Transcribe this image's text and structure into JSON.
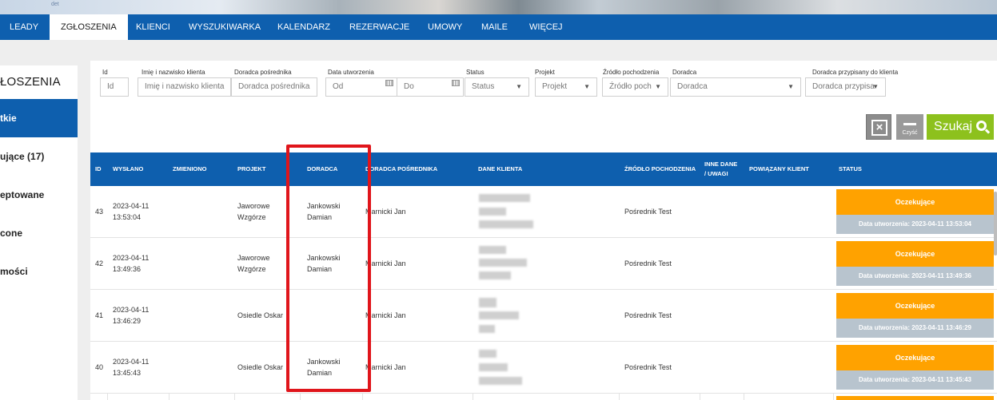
{
  "banner": {
    "logo_text": "det"
  },
  "nav": {
    "items": [
      {
        "label": "LEADY"
      },
      {
        "label": "ZGŁOSZENIA",
        "active": true
      },
      {
        "label": "KLIENCI"
      },
      {
        "label": "WYSZUKIWARKA"
      },
      {
        "label": "KALENDARZ"
      },
      {
        "label": "REZERWACJE"
      },
      {
        "label": "UMOWY"
      },
      {
        "label": "MAILE"
      },
      {
        "label": "WIĘCEJ"
      }
    ]
  },
  "sidebar": {
    "title": "ŁOSZENIA",
    "items": [
      {
        "label": "tkie",
        "active": true
      },
      {
        "label": "ujące (17)"
      },
      {
        "label": "eptowane"
      },
      {
        "label": "cone"
      },
      {
        "label": "mości"
      }
    ]
  },
  "filters": {
    "id": {
      "label": "Id",
      "placeholder": "Id"
    },
    "client_name": {
      "label": "Imię i nazwisko klienta",
      "placeholder": "Imię i nazwisko klienta"
    },
    "broker": {
      "label": "Doradca pośrednika",
      "placeholder": "Doradca pośrednika"
    },
    "created_date": {
      "label": "Data utworzenia",
      "from": "Od",
      "to": "Do"
    },
    "status": {
      "label": "Status",
      "value": "Status"
    },
    "project": {
      "label": "Projekt",
      "value": "Projekt"
    },
    "source": {
      "label": "Źródło pochodzenia",
      "value": "Źródło poch"
    },
    "advisor": {
      "label": "Doradca",
      "value": "Doradca"
    },
    "assigned_advisor": {
      "label": "Doradca przypisany do klienta",
      "value": "Doradca przypisa"
    }
  },
  "actions": {
    "clear_label": "Czyść",
    "search_label": "Szukaj"
  },
  "table": {
    "headers": {
      "id": "ID",
      "sent": "WYSŁANO",
      "changed": "ZMIENIONO",
      "project": "PROJEKT",
      "advisor": "DORADCA",
      "broker_advisor": "DORADCA POŚREDNIKA",
      "client_data": "DANE KLIENTA",
      "source": "ŹRÓDŁO POCHODZENIA",
      "other_1": "INNE DANE",
      "other_2": "/ UWAGI",
      "linked_client": "POWIĄZANY KLIENT",
      "status": "STATUS"
    },
    "rows": [
      {
        "id": "43",
        "sent_date": "2023-04-11",
        "sent_time": "13:53:04",
        "project_1": "Jaworowe",
        "project_2": "Wzgórze",
        "advisor_1": "Jankowski",
        "advisor_2": "Damian",
        "broker": "Marnicki Jan",
        "source": "Pośrednik Test",
        "status": "Oczekujące",
        "status_info": "Data utworzenia: 2023-04-11 13:53:04"
      },
      {
        "id": "42",
        "sent_date": "2023-04-11",
        "sent_time": "13:49:36",
        "project_1": "Jaworowe",
        "project_2": "Wzgórze",
        "advisor_1": "Jankowski",
        "advisor_2": "Damian",
        "broker": "Marnicki Jan",
        "source": "Pośrednik Test",
        "status": "Oczekujące",
        "status_info": "Data utworzenia: 2023-04-11 13:49:36"
      },
      {
        "id": "41",
        "sent_date": "2023-04-11",
        "sent_time": "13:46:29",
        "project_1": "Osiedle Oskar",
        "project_2": "",
        "advisor_1": "",
        "advisor_2": "",
        "broker": "Marnicki Jan",
        "source": "Pośrednik Test",
        "status": "Oczekujące",
        "status_info": "Data utworzenia: 2023-04-11 13:46:29"
      },
      {
        "id": "40",
        "sent_date": "2023-04-11",
        "sent_time": "13:45:43",
        "project_1": "Osiedle Oskar",
        "project_2": "",
        "advisor_1": "Jankowski",
        "advisor_2": "Damian",
        "broker": "Marnicki Jan",
        "source": "Pośrednik Test",
        "status": "Oczekujące",
        "status_info": "Data utworzenia: 2023-04-11 13:45:43"
      }
    ]
  },
  "colors": {
    "nav_blue": "#0e5fae",
    "status_orange": "#ffa200",
    "search_green": "#8dc11d",
    "highlight_red": "#e0151b"
  }
}
